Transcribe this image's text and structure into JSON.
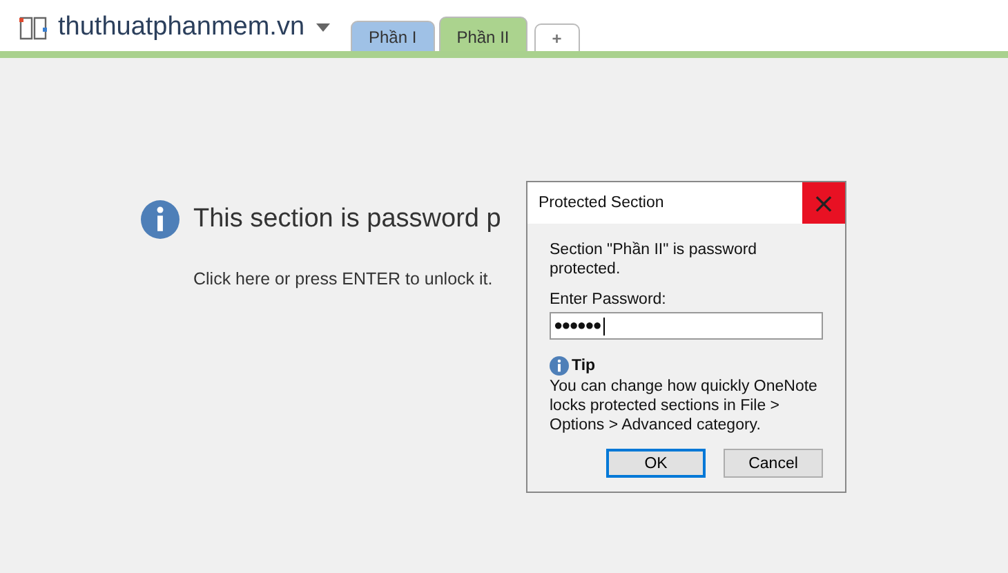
{
  "notebook": {
    "title": "thuthuatphanmem.vn"
  },
  "tabs": [
    {
      "label": "Phần I",
      "selected": false,
      "color": "#9fc1e6",
      "kind": "section"
    },
    {
      "label": "Phần II",
      "selected": true,
      "color": "#abd38e",
      "kind": "section"
    },
    {
      "label": "+",
      "kind": "add"
    }
  ],
  "message": {
    "heading": "This section is password p",
    "hint": "Click here or press ENTER to unlock it."
  },
  "dialog": {
    "title": "Protected Section",
    "close": "×",
    "text": "Section \"Phần II\" is password protected.",
    "field_label": "Enter Password:",
    "password": "●●●●●●",
    "tip_title": "Tip",
    "tip_text": "You can change how quickly OneNote locks protected sections in File > Options > Advanced category.",
    "buttons": [
      {
        "label": "OK",
        "default": true
      },
      {
        "label": "Cancel",
        "default": false
      }
    ]
  }
}
